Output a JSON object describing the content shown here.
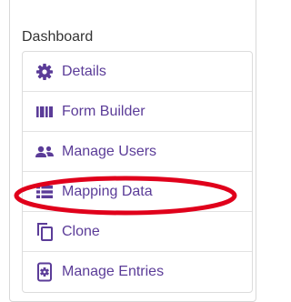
{
  "dashboard": {
    "heading": "Dashboard",
    "items": [
      {
        "label": "Details",
        "icon": "gear-icon"
      },
      {
        "label": "Form Builder",
        "icon": "form-builder-icon"
      },
      {
        "label": "Manage Users",
        "icon": "users-icon"
      },
      {
        "label": "Mapping Data",
        "icon": "list-icon"
      },
      {
        "label": "Clone",
        "icon": "clone-icon"
      },
      {
        "label": "Manage Entries",
        "icon": "manage-entries-icon"
      }
    ]
  },
  "colors": {
    "link": "#5b3c98",
    "annotation": "#e0001b",
    "border": "#dcdcdc"
  }
}
